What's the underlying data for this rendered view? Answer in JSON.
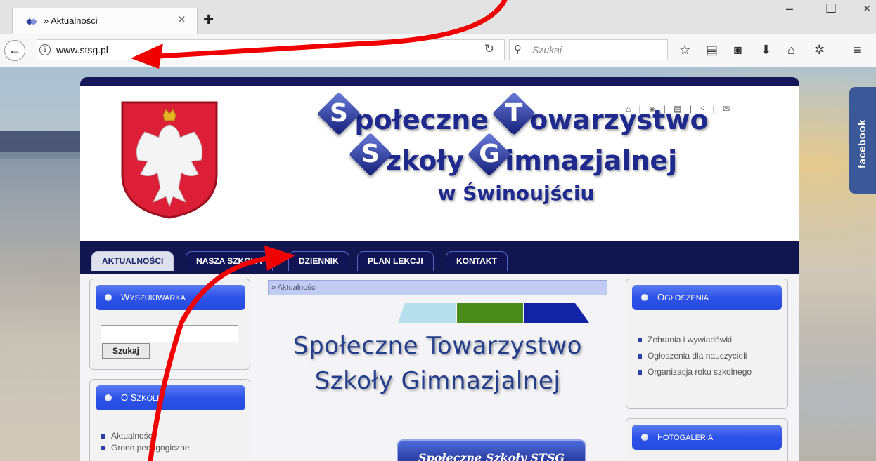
{
  "browser": {
    "tab_title": "» Aktualności",
    "tab_close": "×",
    "new_tab": "+",
    "window_controls": {
      "minimize": "–",
      "maximize": "☐",
      "close": "×"
    },
    "url": "www.stsg.pl",
    "search_placeholder": "Szukaj",
    "toolbar_icons": [
      "star-icon",
      "reader-icon",
      "pocket-icon",
      "download-icon",
      "home-icon",
      "extension-icon",
      "menu-icon"
    ]
  },
  "facebook_tab": "facebook",
  "site": {
    "title": {
      "line1": [
        {
          "initial": "S",
          "rest": "połeczne"
        },
        {
          "initial": "T",
          "rest": "owarzystwo"
        }
      ],
      "line2": [
        {
          "initial": "S",
          "rest": "zkoły"
        },
        {
          "initial": "G",
          "rest": "imnazjalnej"
        }
      ],
      "line3": "w Świnoujściu"
    },
    "nav": [
      "AKTUALNOŚCI",
      "NASZA SZKOŁA",
      "DZIENNIK",
      "PLAN LEKCJI",
      "KONTAKT"
    ],
    "active_nav": "AKTUALNOŚCI",
    "left": {
      "search_box": {
        "title_first": "W",
        "title_rest": "YSZUKIWARKA",
        "button": "Szukaj",
        "value": ""
      },
      "about_box": {
        "title_first": "O S",
        "title_rest": "ZKOLE",
        "items": [
          "Aktualności",
          "Grono pedagogiczne"
        ]
      }
    },
    "center": {
      "breadcrumb": "» Aktualności",
      "bar_colors": [
        "#b7e0ee",
        "#4a8c1c",
        "#1323a6"
      ],
      "logo_line1": "Społeczne Towarzystwo",
      "logo_line2": "Szkoły Gimnazjalnej",
      "pill_text": "Społeczne Szkoły STSG"
    },
    "right": {
      "announcements": {
        "title_first": "O",
        "title_rest": "GŁOSZENIA",
        "items": [
          "Zebrania i wywiadówki",
          "Ogłoszenia dla nauczycieli",
          "Organizacja roku szkolnego"
        ]
      },
      "gallery": {
        "title_first": "F",
        "title_rest": "OTOGALERIA"
      }
    }
  },
  "colors": {
    "annotation_arrow": "#f00000",
    "nav_bar": "#111550",
    "box_header": "#2d52e8",
    "facebook": "#3b5998"
  }
}
